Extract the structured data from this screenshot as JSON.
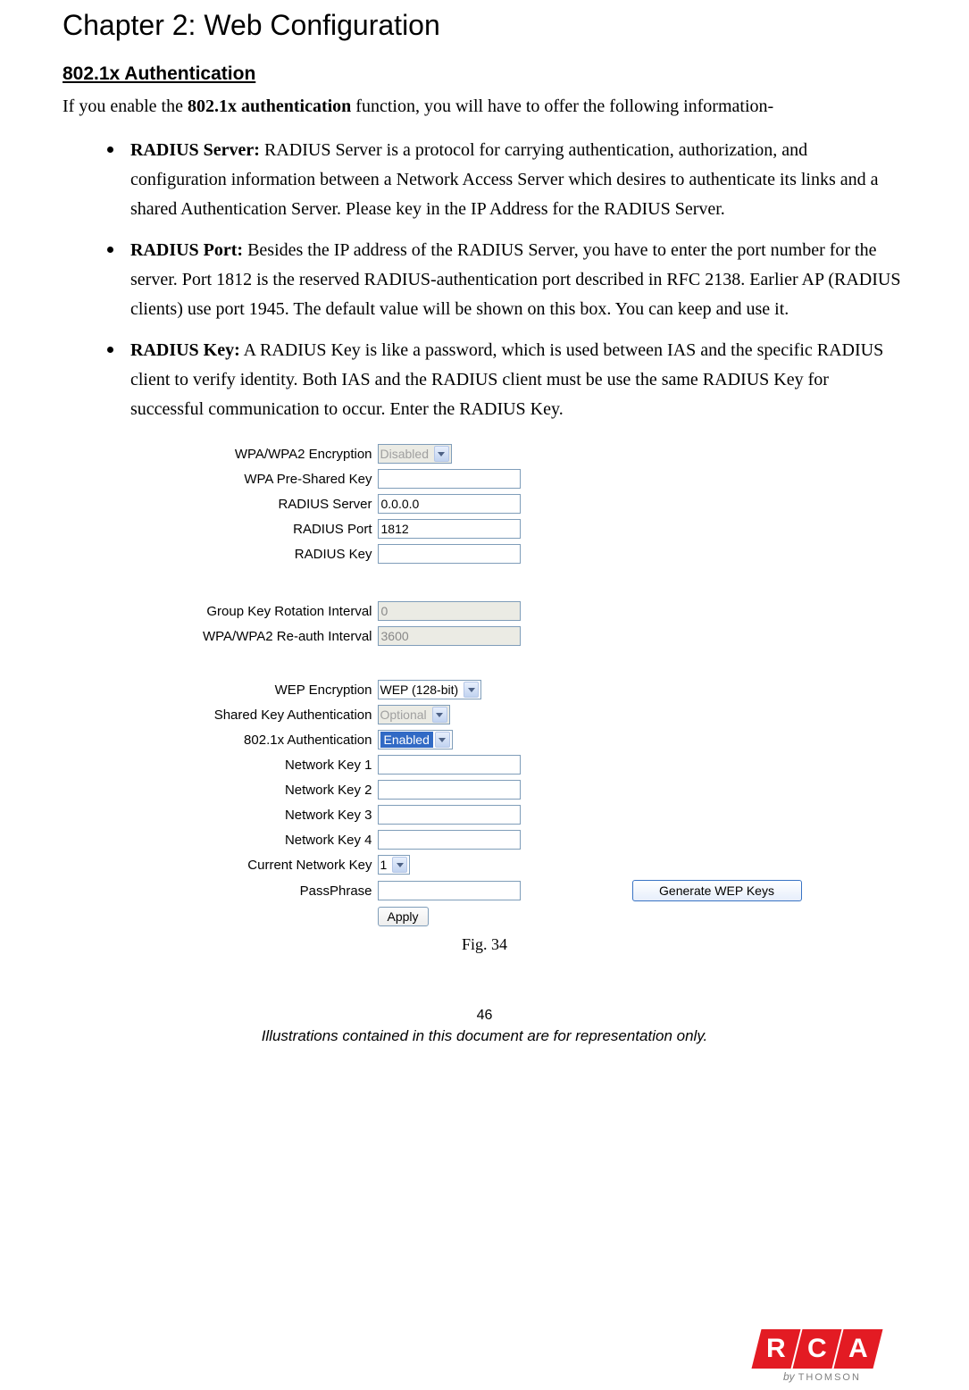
{
  "chapter_title": "Chapter 2: Web Configuration",
  "section_title": "802.1x Authentication",
  "intro_pre": "If you enable the ",
  "intro_bold": "802.1x authentication",
  "intro_post": " function, you will have to offer the following information-",
  "bullets": [
    {
      "label": "RADIUS Server:",
      "text": " RADIUS Server is a protocol for carrying authentication, authorization, and configuration information between a Network Access Server which desires to authenticate its links and a shared Authentication Server. Please key in the IP Address for the RADIUS Server."
    },
    {
      "label": "RADIUS Port:",
      "text": " Besides the IP address of the RADIUS Server, you have to enter the port number for the server. Port 1812 is the reserved RADIUS-authentication port described in RFC 2138. Earlier AP (RADIUS clients) use port 1945. The default value will be shown on this box. You can keep and use it."
    },
    {
      "label": "RADIUS Key:",
      "text": " A RADIUS Key is like a password, which is used between IAS and the specific RADIUS client to verify identity. Both IAS and the RADIUS client must be use the same RADIUS Key for successful communication to occur. Enter the RADIUS Key."
    }
  ],
  "form": {
    "wpa_encryption": {
      "label": "WPA/WPA2 Encryption",
      "value": "Disabled"
    },
    "wpa_psk": {
      "label": "WPA Pre-Shared Key",
      "value": ""
    },
    "radius_server": {
      "label": "RADIUS Server",
      "value": "0.0.0.0"
    },
    "radius_port": {
      "label": "RADIUS Port",
      "value": "1812"
    },
    "radius_key": {
      "label": "RADIUS Key",
      "value": ""
    },
    "group_key": {
      "label": "Group Key Rotation Interval",
      "value": "0"
    },
    "reauth": {
      "label": "WPA/WPA2 Re-auth Interval",
      "value": "3600"
    },
    "wep_encryption": {
      "label": "WEP Encryption",
      "value": "WEP (128-bit)"
    },
    "shared_key_auth": {
      "label": "Shared Key Authentication",
      "value": "Optional"
    },
    "auth_8021x": {
      "label": "802.1x Authentication",
      "value": "Enabled"
    },
    "netkey1": {
      "label": "Network Key 1",
      "value": ""
    },
    "netkey2": {
      "label": "Network Key 2",
      "value": ""
    },
    "netkey3": {
      "label": "Network Key 3",
      "value": ""
    },
    "netkey4": {
      "label": "Network Key 4",
      "value": ""
    },
    "current_key": {
      "label": "Current Network Key",
      "value": "1"
    },
    "passphrase": {
      "label": "PassPhrase",
      "value": ""
    },
    "generate_btn": "Generate WEP Keys",
    "apply_btn": "Apply"
  },
  "fig_caption": "Fig. 34",
  "page_number": "46",
  "disclaimer": "Illustrations contained in this document are for representation only.",
  "logo": {
    "r": "R",
    "c": "C",
    "a": "A",
    "by": "by",
    "brand": "THOMSON"
  }
}
